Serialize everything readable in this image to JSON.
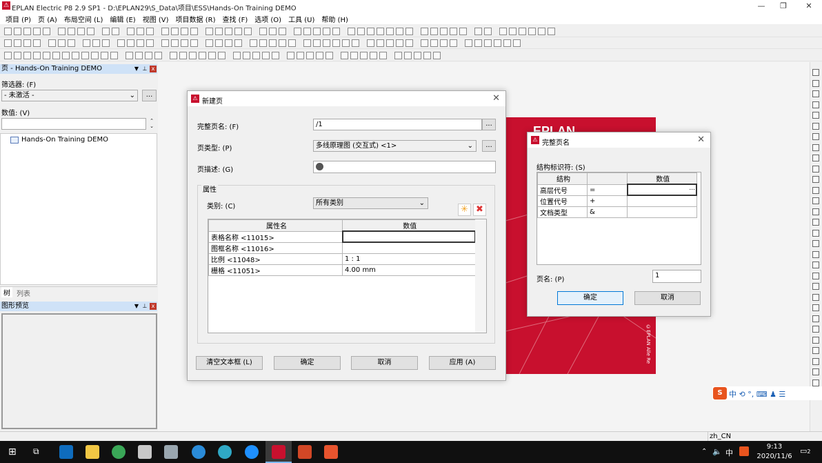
{
  "window": {
    "title": "EPLAN Electric P8 2.9 SP1 - D:\\EPLAN29\\S_Data\\项目\\ESS\\Hands-On Training DEMO",
    "minimize": "—",
    "maximize": "❐",
    "close": "✕"
  },
  "menu": [
    "项目 (P)",
    "页 (A)",
    "布局空间 (L)",
    "编辑 (E)",
    "视图 (V)",
    "项目数据 (R)",
    "查找 (F)",
    "选项 (O)",
    "工具 (U)",
    "帮助 (H)"
  ],
  "page_panel": {
    "title": "页 - Hands-On Training DEMO",
    "filter_label": "筛选器: (F)",
    "filter_value": "- 未激活 -",
    "filter_btn": "...",
    "value_label": "数值: (V)",
    "tree_item": "Hands-On Training DEMO",
    "tab_tree": "树",
    "tab_list": "列表"
  },
  "preview_panel": {
    "title": "图形预览"
  },
  "new_page": {
    "title": "新建页",
    "full_name_label": "完整页名: (F)",
    "full_name_value": "/1",
    "page_type_label": "页类型: (P)",
    "page_type_value": "多线原理图 (交互式) <1>",
    "desc_label": "页描述: (G)",
    "props_label": "属性",
    "category_label": "类别: (C)",
    "category_value": "所有类别",
    "col_name": "属性名",
    "col_value": "数值",
    "rows": [
      {
        "name": "表格名称 <11015>",
        "value": ""
      },
      {
        "name": "图框名称 <11016>",
        "value": ""
      },
      {
        "name": "比例 <11048>",
        "value": "1 : 1"
      },
      {
        "name": "栅格 <11051>",
        "value": "4.00 mm"
      }
    ],
    "btn_clear": "清空文本框 (L)",
    "btn_ok": "确定",
    "btn_cancel": "取消",
    "btn_apply": "应用 (A)",
    "dots": "..."
  },
  "full_page": {
    "title": "完整页名",
    "struct_label": "结构标识符: (S)",
    "col_struct": "结构",
    "col_value": "数值",
    "rows": [
      {
        "name": "高层代号",
        "sym": "="
      },
      {
        "name": "位置代号",
        "sym": "+"
      },
      {
        "name": "文档类型",
        "sym": "&"
      }
    ],
    "page_label": "页名: (P)",
    "page_value": "1",
    "btn_ok": "确定",
    "btn_cancel": "取消",
    "dots": "..."
  },
  "background": {
    "logo": "EPLAN",
    "side_text": "©EPLAN Alle Re"
  },
  "status": {
    "locale": "zh_CN"
  },
  "ime": {
    "chars": "中 ⟲ °, ⌨ ♟ ☰"
  },
  "taskbar": {
    "time": "9:13",
    "date": "2020/11/6",
    "ime_cn": "中",
    "notif": "2"
  }
}
